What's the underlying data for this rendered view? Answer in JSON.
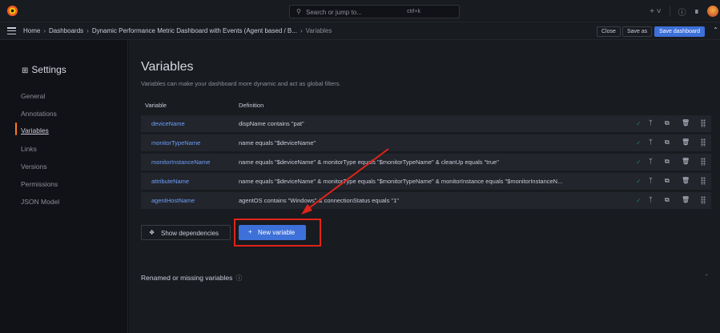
{
  "topbar": {
    "search_placeholder": "Search or jump to...",
    "search_shortcut": "ctrl+k",
    "add_label": "+ ˅",
    "help_icon": "?",
    "news_icon": "rss"
  },
  "breadcrumb": {
    "items": [
      "Home",
      "Dashboards",
      "Dynamic Performance Metric Dashboard with Events (Agent based / B...",
      "Variables"
    ],
    "close_label": "Close",
    "save_as_label": "Save as",
    "save_dashboard_label": "Save dashboard"
  },
  "sidebar": {
    "title": "Settings",
    "items": [
      {
        "label": "General"
      },
      {
        "label": "Annotations"
      },
      {
        "label": "Variables",
        "active": true
      },
      {
        "label": "Links"
      },
      {
        "label": "Versions"
      },
      {
        "label": "Permissions"
      },
      {
        "label": "JSON Model"
      }
    ]
  },
  "main": {
    "title": "Variables",
    "subtitle": "Variables can make your dashboard more dynamic and act as global filters.",
    "columns": [
      "Variable",
      "Definition"
    ],
    "rows": [
      {
        "name": "deviceName",
        "definition": "dispName contains \"pat\""
      },
      {
        "name": "monitorTypeName",
        "definition": "name equals \"$deviceName\""
      },
      {
        "name": "monitorInstanceName",
        "definition": "name equals \"$deviceName\" & monitorType equals \"$monitorTypeName\" & cleanUp equals \"true\""
      },
      {
        "name": "attributeName",
        "definition": "name equals \"$deviceName\" & monitorType equals \"$monitorTypeName\" & monitorInstance equals \"$monitorInstanceN..."
      },
      {
        "name": "agentHostName",
        "definition": "agentOS contains \"Windows\" & connectionStatus equals \"1\""
      }
    ],
    "show_dependencies_label": "Show dependencies",
    "new_variable_label": "New variable",
    "renamed_label": "Renamed or missing variables"
  },
  "colors": {
    "accent": "#3d71d9",
    "link": "#6e9fff",
    "active_marker": "#ff7a1a",
    "annotation": "#e0241a",
    "ok": "#1a7f4b"
  }
}
